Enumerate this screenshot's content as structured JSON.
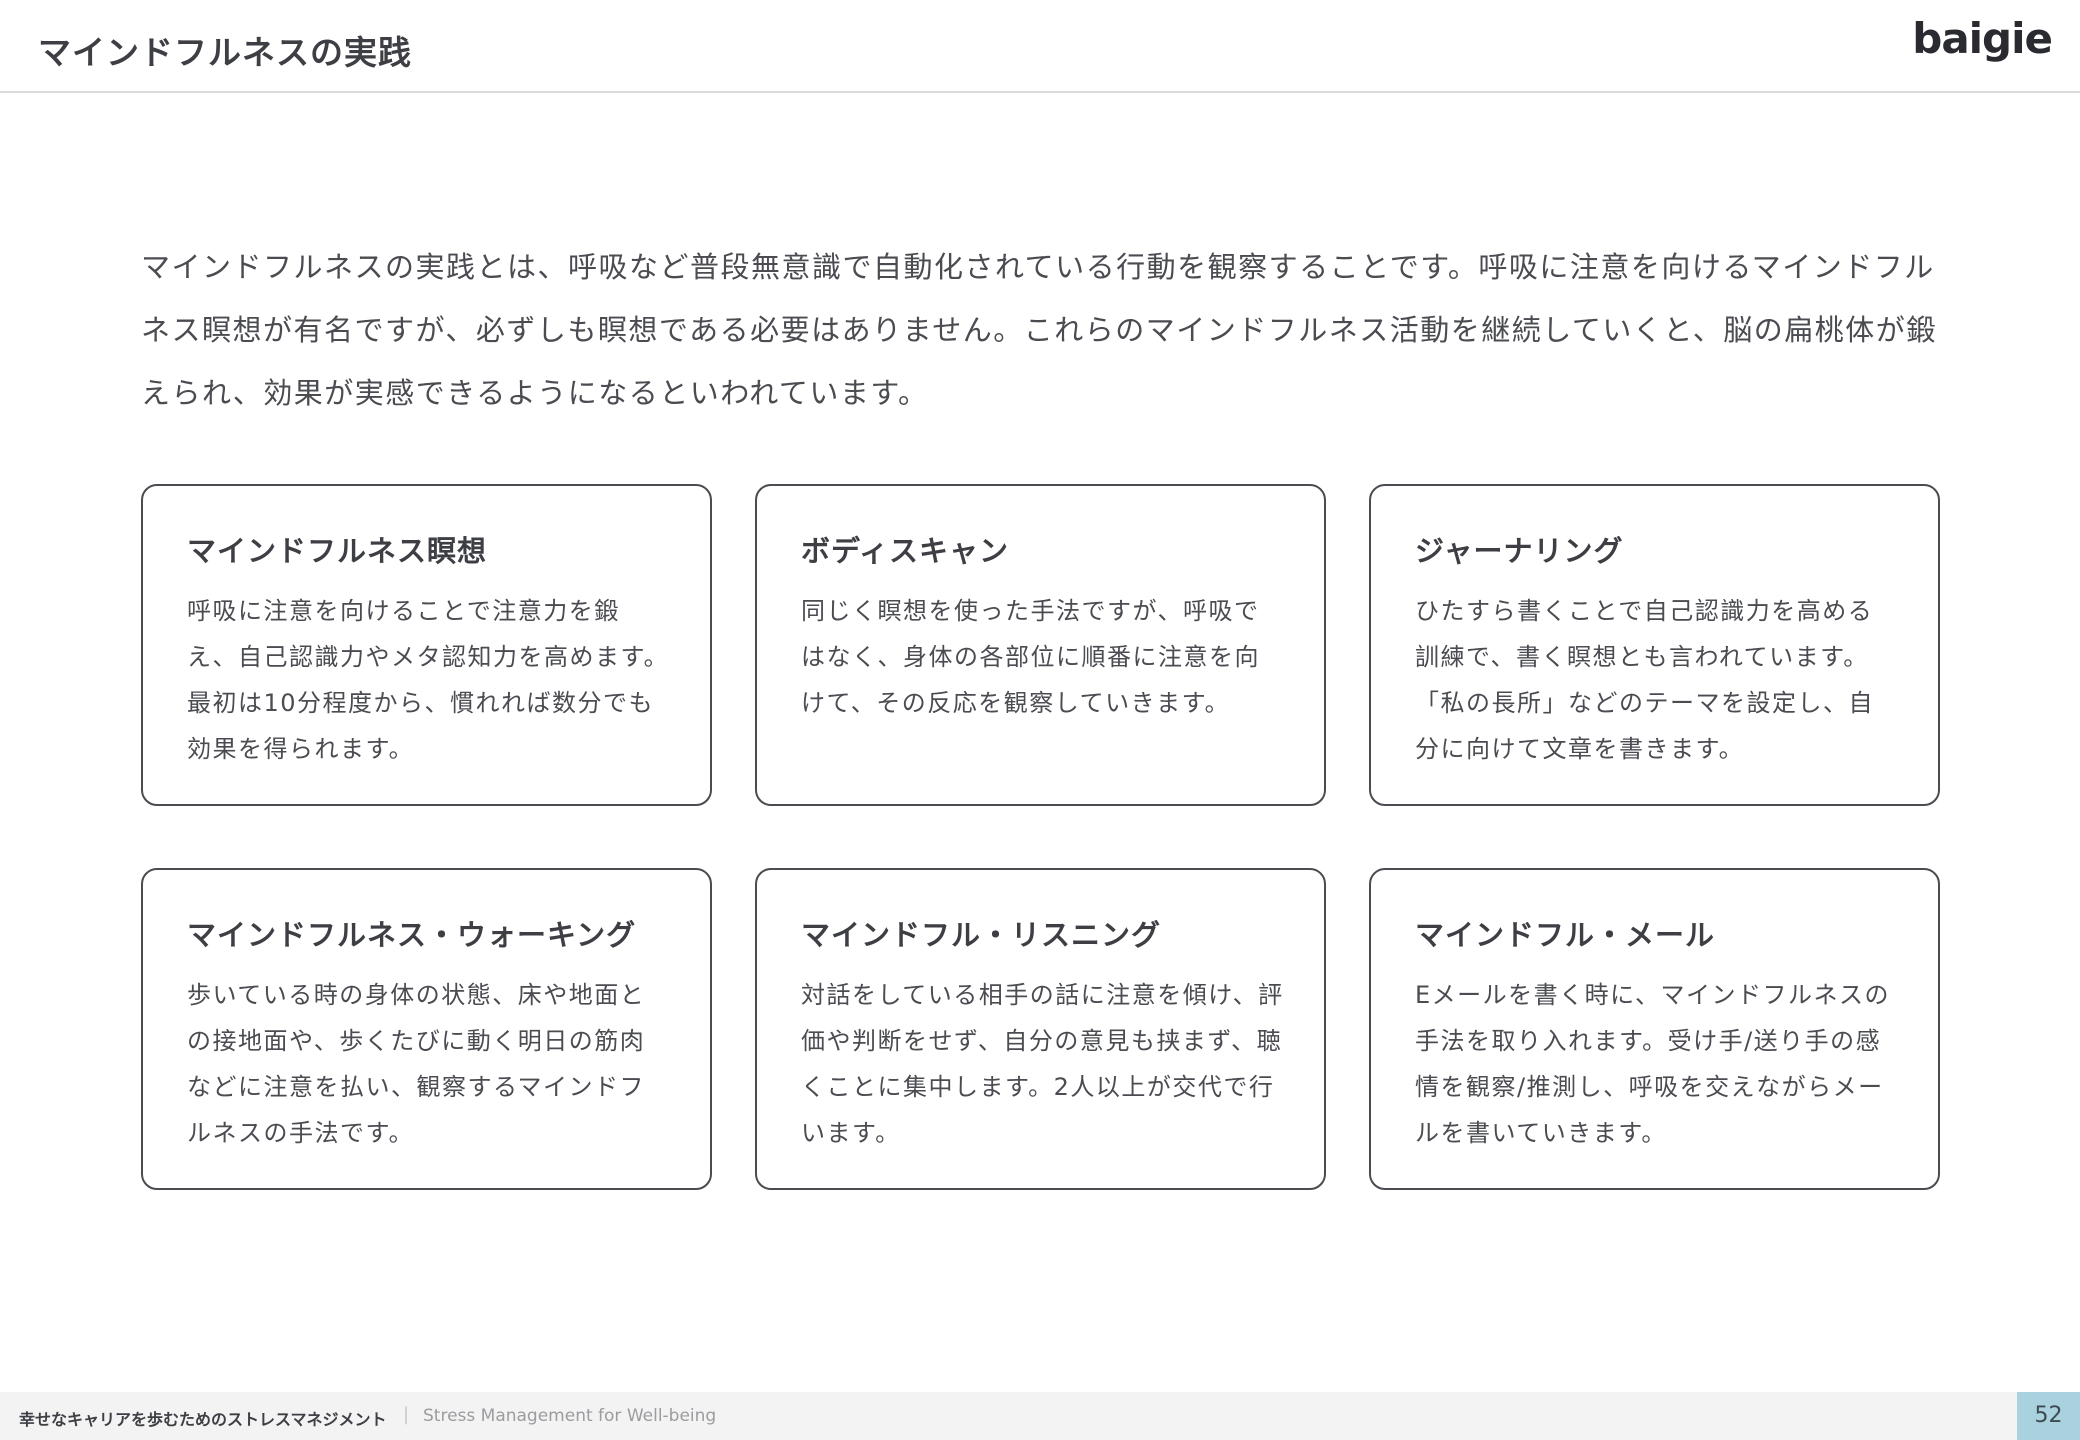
{
  "header": {
    "title": "マインドフルネスの実践",
    "logo": "baigie"
  },
  "intro": "マインドフルネスの実践とは、呼吸など普段無意識で自動化されている行動を観察することです。呼吸に注意を向けるマインドフルネス瞑想が有名ですが、必ずしも瞑想である必要はありません。これらのマインドフルネス活動を継続していくと、脳の扁桃体が鍛えられ、効果が実感できるようになるといわれています。",
  "cards": [
    {
      "title": "マインドフルネス瞑想",
      "body": "呼吸に注意を向けることで注意力を鍛え、自己認識力やメタ認知力を高めます。最初は10分程度から、慣れれば数分でも効果を得られます。"
    },
    {
      "title": "ボディスキャン",
      "body": "同じく瞑想を使った手法ですが、呼吸ではなく、身体の各部位に順番に注意を向けて、その反応を観察していきます。"
    },
    {
      "title": "ジャーナリング",
      "body": "ひたすら書くことで自己認識力を高める訓練で、書く瞑想とも言われています。「私の長所」などのテーマを設定し、自分に向けて文章を書きます。"
    },
    {
      "title": "マインドフルネス・ウォーキング",
      "body": "歩いている時の身体の状態、床や地面との接地面や、歩くたびに動く明日の筋肉などに注意を払い、観察するマインドフルネスの手法です。"
    },
    {
      "title": "マインドフル・リスニング",
      "body": "対話をしている相手の話に注意を傾け、評価や判断をせず、自分の意見も挟まず、聴くことに集中します。2人以上が交代で行います。"
    },
    {
      "title": "マインドフル・メール",
      "body": "Eメールを書く時に、マインドフルネスの手法を取り入れます。受け手/送り手の感情を観察/推測し、呼吸を交えながらメールを書いていきます。"
    }
  ],
  "footer": {
    "title": "幸せなキャリアを歩むためのストレスマネジメント",
    "separator": "|",
    "subtitle": "Stress Management for Well-being",
    "page_number": "52"
  }
}
